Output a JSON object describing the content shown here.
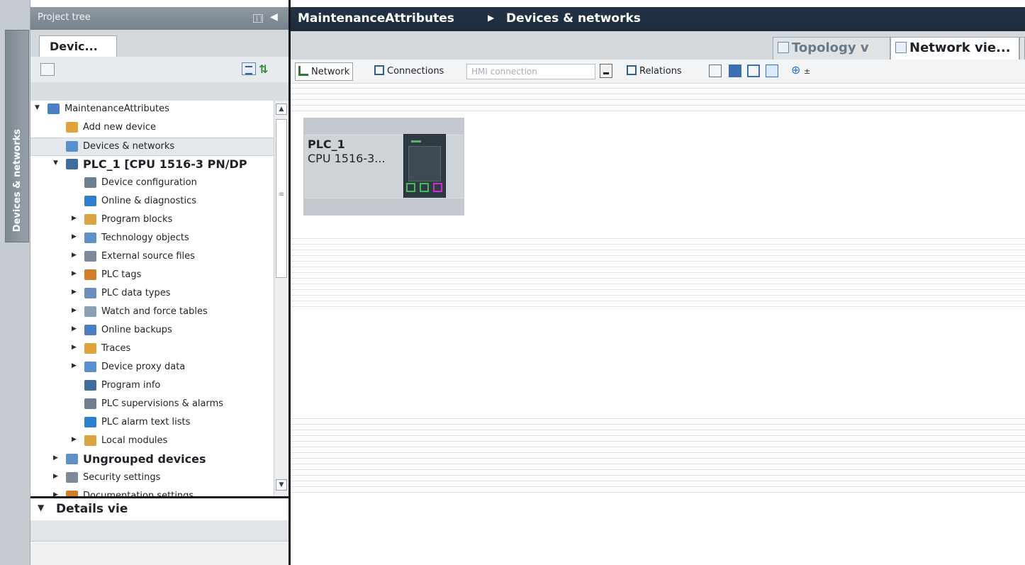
{
  "side_tab": {
    "label": "Devices & networks"
  },
  "project_tree": {
    "title": "Project tree",
    "tab_label": "Devic...",
    "items": [
      {
        "label": "MaintenanceAttributes",
        "level": 0,
        "expander": "expanded",
        "icon": "project-icon"
      },
      {
        "label": "Add new device",
        "level": 1,
        "expander": "none",
        "icon": "add-device-icon"
      },
      {
        "label": "Devices & networks",
        "level": 1,
        "expander": "none",
        "icon": "network-icon",
        "selected": true
      },
      {
        "label": "PLC_1 [CPU 1516-3 PN/DP",
        "level": 1,
        "expander": "expanded",
        "icon": "plc-icon",
        "bold": true
      },
      {
        "label": "Device configuration",
        "level": 2,
        "expander": "none",
        "icon": "device-config-icon"
      },
      {
        "label": "Online & diagnostics",
        "level": 2,
        "expander": "none",
        "icon": "diagnostics-icon"
      },
      {
        "label": "Program blocks",
        "level": 2,
        "expander": "collapsed",
        "icon": "folder-blocks-icon"
      },
      {
        "label": "Technology objects",
        "level": 2,
        "expander": "collapsed",
        "icon": "folder-tech-icon"
      },
      {
        "label": "External source files",
        "level": 2,
        "expander": "collapsed",
        "icon": "folder-source-icon"
      },
      {
        "label": "PLC tags",
        "level": 2,
        "expander": "collapsed",
        "icon": "folder-tags-icon"
      },
      {
        "label": "PLC data types",
        "level": 2,
        "expander": "collapsed",
        "icon": "folder-datatypes-icon"
      },
      {
        "label": "Watch and force tables",
        "level": 2,
        "expander": "collapsed",
        "icon": "folder-watch-icon"
      },
      {
        "label": "Online backups",
        "level": 2,
        "expander": "collapsed",
        "icon": "folder-backup-icon"
      },
      {
        "label": "Traces",
        "level": 2,
        "expander": "collapsed",
        "icon": "folder-traces-icon"
      },
      {
        "label": "Device proxy data",
        "level": 2,
        "expander": "collapsed",
        "icon": "folder-proxy-icon"
      },
      {
        "label": "Program info",
        "level": 2,
        "expander": "none",
        "icon": "program-info-icon"
      },
      {
        "label": "PLC supervisions & alarms",
        "level": 2,
        "expander": "none",
        "icon": "alarms-icon"
      },
      {
        "label": "PLC alarm text lists",
        "level": 2,
        "expander": "none",
        "icon": "text-list-icon"
      },
      {
        "label": "Local modules",
        "level": 2,
        "expander": "collapsed",
        "icon": "folder-modules-icon"
      },
      {
        "label": "Ungrouped devices",
        "level": 1,
        "expander": "collapsed",
        "icon": "ungrouped-icon",
        "bold": true
      },
      {
        "label": "Security settings",
        "level": 1,
        "expander": "collapsed",
        "icon": "security-icon"
      },
      {
        "label": "Documentation settings",
        "level": 1,
        "expander": "collapsed",
        "icon": "documentation-icon"
      }
    ]
  },
  "details_view": {
    "title": "Details vie"
  },
  "editor": {
    "breadcrumb": [
      "MaintenanceAttributes",
      "Devices & networks"
    ],
    "view_tabs": [
      {
        "label": "Topology v",
        "active": false
      },
      {
        "label": "Network vie...",
        "active": true
      }
    ],
    "toolbar": {
      "network_label": "Network",
      "connections_label": "Connections",
      "connection_type_value": "HMI connection",
      "relations_label": "Relations"
    }
  },
  "device": {
    "name": "PLC_1",
    "type": "CPU 1516-3..."
  },
  "colors": {
    "title_bar": "#1f2e3e",
    "port_green": "#3fc04e",
    "port_magenta": "#d02ad0"
  }
}
